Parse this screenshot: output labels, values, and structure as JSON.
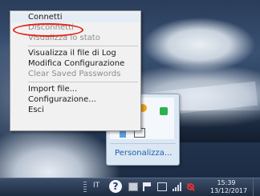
{
  "menu": {
    "items": [
      {
        "label": "Connetti",
        "enabled": true
      },
      {
        "label": "Disconnetti",
        "enabled": false,
        "highlighted_with_red_circle": true
      },
      {
        "label": "Visualizza lo stato",
        "enabled": false
      },
      {
        "label": "Visualizza il file di Log",
        "enabled": true
      },
      {
        "label": "Modifica Configurazione",
        "enabled": true
      },
      {
        "label": "Clear Saved Passwords",
        "enabled": false
      },
      {
        "label": "Import file...",
        "enabled": true
      },
      {
        "label": "Configurazione...",
        "enabled": true
      },
      {
        "label": "Esci",
        "enabled": true
      }
    ]
  },
  "tray_popup": {
    "customize_link": "Personalizza..."
  },
  "taskbar": {
    "language": "IT",
    "help_glyph": "?",
    "time": "15:39",
    "date": "13/12/2017"
  },
  "colors": {
    "annotation_red": "#e2231a",
    "menu_background": "#f1f1f1",
    "disabled_text": "#8d8d8d",
    "link_blue": "#1e5fae"
  },
  "icons": [
    "help-icon",
    "action-center-icon",
    "network-icon",
    "volume-icon",
    "signal-icon",
    "openvpn-icon"
  ]
}
